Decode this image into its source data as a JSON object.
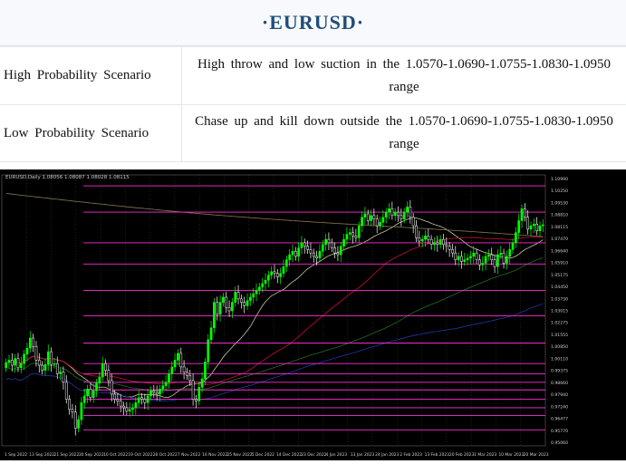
{
  "title": "·EURUSD·",
  "scenarios": [
    {
      "label": "High Probability Scenario",
      "text": "High throw and low suction in the 1.0570-1.0690-1.0755-1.0830-1.0950 range"
    },
    {
      "label": "Low Probability Scenario",
      "text": "Chase up and kill down outside the 1.0570-1.0690-1.0755-1.0830-1.0950 range"
    }
  ],
  "chart": {
    "header": "EURUSD,Daily  1.08056 1.08087 1.08028 1.08115",
    "colors": {
      "up": "#00ff00",
      "down": "#ffffff",
      "level": "#ff2bd6",
      "grid": "#3a3a3a",
      "ma_red": "#c8102e",
      "ma_blue": "#1a3aa8",
      "ma_green": "#1f6f1f",
      "ma_tan": "#8a7a52",
      "ma_light": "#c8c8a0"
    },
    "price_labels": [
      "1.10990",
      "1.10250",
      "1.09530",
      "1.08810",
      "1.08115",
      "1.07470",
      "1.06640",
      "1.05910",
      "1.05175",
      "1.04450",
      "1.03730",
      "1.03015",
      "1.02275",
      "1.01555",
      "1.00850",
      "1.00110",
      "0.99375",
      "0.98660",
      "0.97940",
      "0.97240",
      "0.96477",
      "0.95770",
      "0.95060"
    ],
    "level_values": [
      1.1035,
      1.088,
      1.07,
      1.0575,
      1.042,
      1.027,
      1.011,
      0.999,
      0.993,
      0.988,
      0.9835,
      0.978,
      0.973,
      0.9685,
      0.96
    ],
    "date_labels": [
      "1 Sep 2022",
      "13 Sep 2022",
      "21 Sep 2022",
      "30 Sep 2022",
      "10 Oct 2022",
      "19 Oct 2022",
      "28 Oct 2022",
      "7 Nov 2022",
      "16 Nov 2022",
      "25 Nov 2022",
      "5 Dec 2022",
      "14 Dec 2022",
      "23 Dec 2022",
      "4 Jan 2023",
      "13 Jan 2023",
      "24 Jan 2023",
      "2 Feb 2023",
      "13 Feb 2023",
      "20 Feb 2023",
      "1 Mar 2023",
      "10 Mar 2023",
      "20 Mar 2023"
    ],
    "y_range": [
      0.9506,
      1.1099
    ],
    "closes": [
      0.9995,
      1.001,
      0.998,
      1.002,
      0.9965,
      0.999,
      1.0045,
      1.008,
      1.014,
      1.009,
      1.001,
      0.998,
      0.995,
      0.9985,
      1.006,
      0.9985,
      0.999,
      0.993,
      0.994,
      0.988,
      0.978,
      0.972,
      0.9705,
      0.961,
      0.966,
      0.976,
      0.98,
      0.984,
      0.979,
      0.983,
      0.9875,
      0.991,
      0.999,
      0.995,
      0.989,
      0.981,
      0.978,
      0.977,
      0.974,
      0.973,
      0.971,
      0.972,
      0.973,
      0.976,
      0.979,
      0.978,
      0.976,
      0.98,
      0.983,
      0.982,
      0.981,
      0.984,
      0.986,
      0.988,
      0.993,
      0.997,
      1.001,
      1.005,
      0.997,
      0.994,
      0.992,
      0.989,
      0.978,
      0.977,
      0.985,
      0.99,
      1.0,
      1.013,
      1.02,
      1.035,
      1.028,
      1.035,
      1.038,
      1.032,
      1.03,
      1.035,
      1.041,
      1.037,
      1.035,
      1.033,
      1.036,
      1.038,
      1.04,
      1.042,
      1.044,
      1.046,
      1.048,
      1.051,
      1.053,
      1.052,
      1.05,
      1.052,
      1.056,
      1.06,
      1.063,
      1.065,
      1.062,
      1.067,
      1.07,
      1.068,
      1.066,
      1.064,
      1.062,
      1.061,
      1.065,
      1.069,
      1.072,
      1.07,
      1.067,
      1.064,
      1.063,
      1.068,
      1.072,
      1.075,
      1.076,
      1.074,
      1.073,
      1.08,
      1.085,
      1.087,
      1.083,
      1.086,
      1.084,
      1.08,
      1.082,
      1.085,
      1.088,
      1.09,
      1.086,
      1.088,
      1.086,
      1.084,
      1.088,
      1.091,
      1.085,
      1.08,
      1.073,
      1.071,
      1.072,
      1.074,
      1.072,
      1.069,
      1.07,
      1.069,
      1.072,
      1.069,
      1.068,
      1.066,
      1.064,
      1.06,
      1.062,
      1.059,
      1.06,
      1.061,
      1.062,
      1.064,
      1.06,
      1.057,
      1.058,
      1.062,
      1.063,
      1.06,
      1.056,
      1.063,
      1.064,
      1.058,
      1.062,
      1.066,
      1.07,
      1.076,
      1.083,
      1.09,
      1.085,
      1.078,
      1.08,
      1.081,
      1.077,
      1.08,
      1.0806
    ]
  }
}
